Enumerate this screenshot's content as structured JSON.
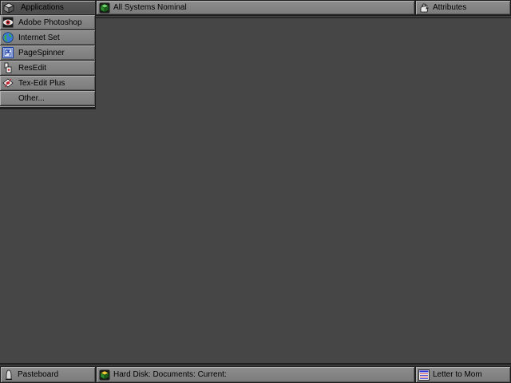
{
  "top_bar": {
    "apps_label": "Applications",
    "status_label": "All Systems Nominal",
    "attributes_label": "Attributes"
  },
  "apps_menu": {
    "items": [
      {
        "label": "Adobe Photoshop",
        "icon": "photoshop-eye-icon"
      },
      {
        "label": "Internet Set",
        "icon": "globe-icon"
      },
      {
        "label": "PageSpinner",
        "icon": "pagespinner-icon"
      },
      {
        "label": "ResEdit",
        "icon": "resedit-jack-icon"
      },
      {
        "label": "Tex-Edit Plus",
        "icon": "texedit-icon"
      }
    ],
    "other_label": "Other..."
  },
  "bottom_bar": {
    "pasteboard_label": "Pasteboard",
    "path_label": "Hard Disk: Documents: Current:",
    "document_label": "Letter to Mom"
  },
  "colors": {
    "desktop": "#464646",
    "bar": "#8a8a8a",
    "bar_active": "#555555",
    "status_green": "#2e8b2e"
  }
}
